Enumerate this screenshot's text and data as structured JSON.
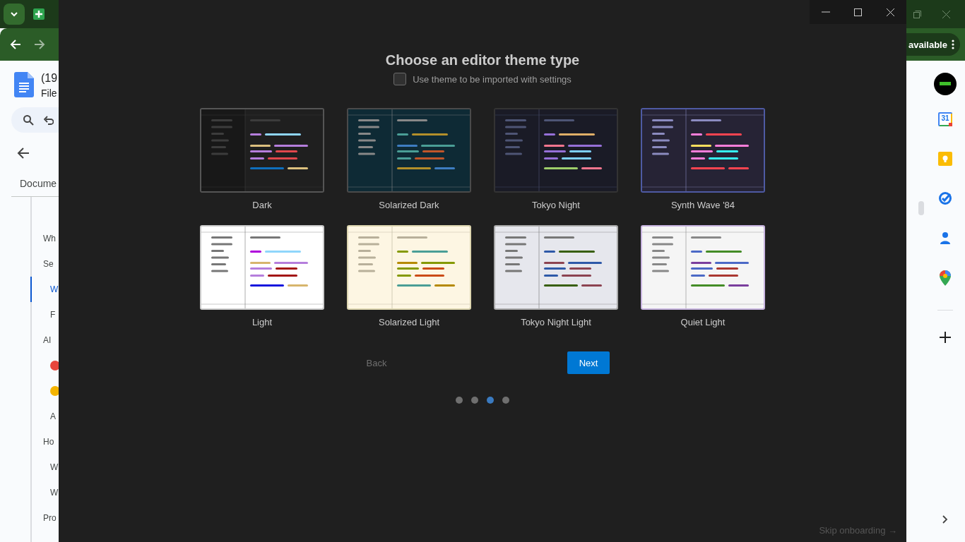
{
  "browser_left": {
    "doc_title": "(19",
    "menu": "File",
    "tab": "Docume",
    "outline": [
      {
        "kind": "text",
        "text": "Wh",
        "selected": false
      },
      {
        "kind": "text",
        "text": "Se",
        "selected": false,
        "children": [
          {
            "kind": "text",
            "text": "W",
            "selected": true
          },
          {
            "kind": "text",
            "text": "F",
            "selected": false
          }
        ]
      },
      {
        "kind": "text",
        "text": "AI",
        "selected": false,
        "children": [
          {
            "kind": "icon",
            "color": "#e8453c",
            "selected": false
          },
          {
            "kind": "icon",
            "color": "#f4b400",
            "selected": false
          },
          {
            "kind": "text",
            "text": "A",
            "selected": false
          }
        ]
      },
      {
        "kind": "text",
        "text": "Ho",
        "selected": false,
        "children": [
          {
            "kind": "text",
            "text": "W",
            "selected": false
          },
          {
            "kind": "text",
            "text": "W",
            "selected": false
          }
        ]
      },
      {
        "kind": "text",
        "text": "Pro",
        "selected": false
      }
    ]
  },
  "browser_right": {
    "update_pill": "available",
    "calendar_day": "31"
  },
  "dialog": {
    "title": "Choose an editor theme type",
    "import_checkbox": {
      "label": "Use theme to be imported with settings",
      "checked": false
    },
    "themes": [
      {
        "name": "Dark",
        "color": "#1f1f1f"
      },
      {
        "name": "Solarized Dark",
        "color": "#0e2a35"
      },
      {
        "name": "Tokyo Night",
        "color": "#1a1b26"
      },
      {
        "name": "Synth Wave '84",
        "color": "#262335"
      },
      {
        "name": "Light",
        "color": "#ffffff"
      },
      {
        "name": "Solarized Light",
        "color": "#fdf6e3"
      },
      {
        "name": "Tokyo Night Light",
        "color": "#e6e7ed"
      },
      {
        "name": "Quiet Light",
        "color": "#f5f5f5"
      }
    ],
    "buttons": [
      {
        "kind": "secondary",
        "label": "Back"
      },
      {
        "kind": "primary",
        "label": "Next"
      }
    ],
    "steps": [
      {
        "selected": false
      },
      {
        "selected": false
      },
      {
        "selected": true
      },
      {
        "selected": false
      }
    ],
    "skip_link": "Skip onboarding →"
  }
}
